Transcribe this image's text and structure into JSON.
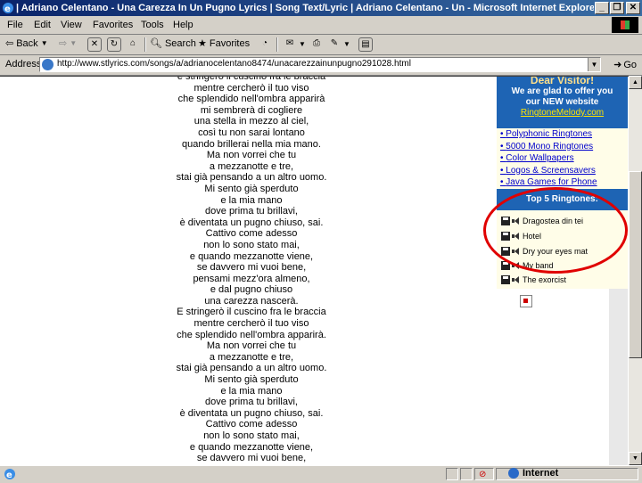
{
  "window": {
    "title": "| Adriano Celentano - Una Carezza In Un Pugno Lyrics | Song Text/Lyric | Adriano Celentano - Un - Microsoft Internet Explorer p"
  },
  "menu": [
    "File",
    "Edit",
    "View",
    "Favorites",
    "Tools",
    "Help"
  ],
  "toolbar": {
    "back": "Back",
    "search": "Search",
    "favorites": "Favorites"
  },
  "address": {
    "label": "Address",
    "url": "http://www.stlyrics.com/songs/a/adrianocelentano8474/unacarezzainunpugno291028.html",
    "go": "Go"
  },
  "lyrics": [
    "e stringerò il cuscino fra le braccia",
    "mentre cercherò il tuo viso",
    "che splendido nell'ombra apparirà",
    "mi sembrerà di cogliere",
    "una stella in mezzo al ciel,",
    "così tu non sarai lontano",
    "quando brillerai nella mia mano.",
    "Ma non vorrei che tu",
    "a mezzanotte e tre,",
    "stai già pensando a un altro uomo.",
    "Mi sento già sperduto",
    "e la mia mano",
    "dove prima tu brillavi,",
    "è diventata un pugno chiuso, sai.",
    "Cattivo come adesso",
    "non lo sono stato mai,",
    "e quando mezzanotte viene,",
    "se davvero mi vuoi bene,",
    "pensami mezz'ora almeno,",
    "e dal pugno chiuso",
    "una carezza nascerà.",
    "E stringerò il cuscino fra le braccia",
    "mentre cercherò il tuo viso",
    "che splendido nell'ombra apparirà.",
    "Ma non vorrei che tu",
    "a mezzanotte e tre,",
    "stai già pensando a un altro uomo.",
    "Mi sento già sperduto",
    "e la mia mano",
    "dove prima tu brillavi,",
    "è diventata un pugno chiuso, sai.",
    "Cattivo come adesso",
    "non lo sono stato mai,",
    "e quando mezzanotte viene,",
    "se davvero mi vuoi bene,"
  ],
  "sidebar": {
    "visitor_heading": "Dear Visitor!",
    "visitor_text_1": "We are glad to offer you",
    "visitor_text_2": "our NEW website",
    "visitor_link": "RingtoneMelody.com",
    "links": [
      "Polyphonic Ringtones",
      "5000 Mono Ringtones",
      "Color Wallpapers",
      "Logos & Screensavers",
      "Java Games for Phone"
    ],
    "top5_heading": "Top 5 Ringtones:",
    "ringtones": [
      "Dragostea din tei",
      "Hotel",
      "Dry your eyes mat",
      "My band",
      "The exorcist"
    ]
  },
  "status": {
    "zone": "Internet"
  },
  "colors": {
    "sidebar_blue": "#1e64b4",
    "highlight_circle": "#e00000",
    "link": "#0000cc"
  }
}
